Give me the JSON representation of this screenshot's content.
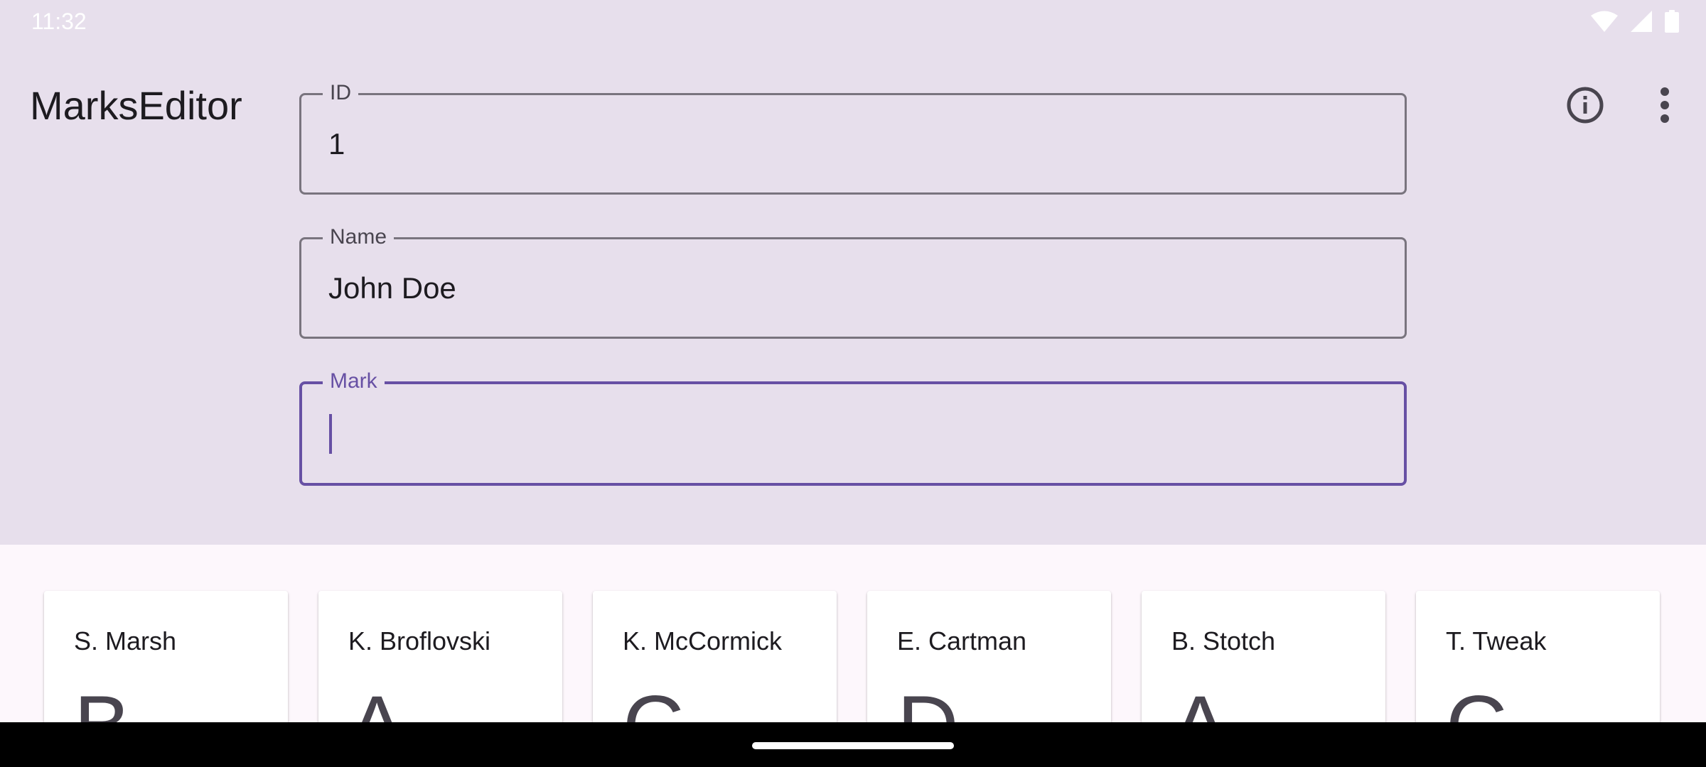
{
  "status_bar": {
    "time": "11:32",
    "icons": [
      "wifi-icon",
      "cell-signal-icon",
      "battery-icon"
    ]
  },
  "app_bar": {
    "title": "MarksEditor",
    "actions": [
      "info-icon",
      "more-vert-icon"
    ]
  },
  "form": {
    "id_field": {
      "label": "ID",
      "value": "1"
    },
    "name_field": {
      "label": "Name",
      "value": "John Doe"
    },
    "mark_field": {
      "label": "Mark",
      "value": "",
      "focused": true
    }
  },
  "students": [
    {
      "name": "S. Marsh",
      "mark": "B"
    },
    {
      "name": "K. Broflovski",
      "mark": "A"
    },
    {
      "name": "K. McCormick",
      "mark": "C"
    },
    {
      "name": "E. Cartman",
      "mark": "D"
    },
    {
      "name": "B. Stotch",
      "mark": "A"
    },
    {
      "name": "T. Tweak",
      "mark": "C"
    }
  ],
  "colors": {
    "top_background": "#e7dfec",
    "page_background": "#fdf7fc",
    "accent": "#6750a4",
    "outline": "#79747e"
  }
}
